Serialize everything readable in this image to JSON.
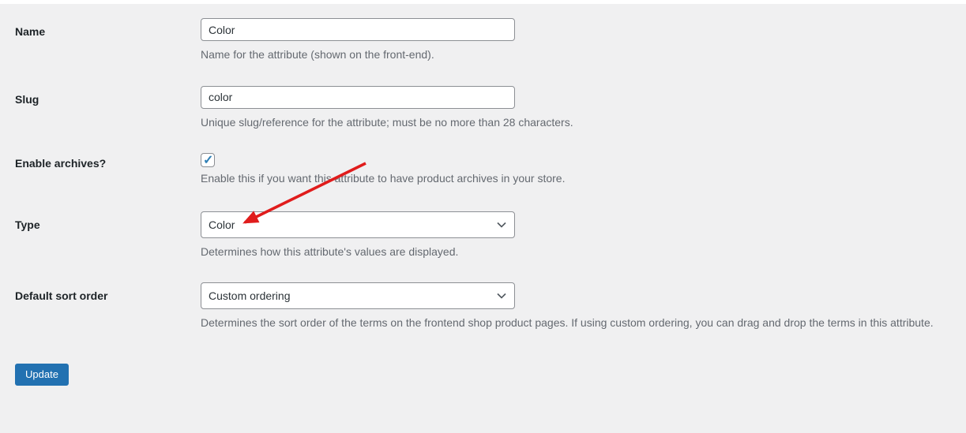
{
  "page": {
    "background": "#f0f0f1",
    "accent_blue": "#2271b1",
    "annotation_red": "#e01c1c"
  },
  "form": {
    "rows": [
      {
        "id": "name",
        "label": "Name",
        "type": "text",
        "value": "Color",
        "help": "Name for the attribute (shown on the front-end)."
      },
      {
        "id": "slug",
        "label": "Slug",
        "type": "text",
        "value": "color",
        "help": "Unique slug/reference for the attribute; must be no more than 28 characters."
      },
      {
        "id": "enable-archives",
        "label": "Enable archives?",
        "type": "checkbox",
        "checked": "checked",
        "help": "Enable this if you want this attribute to have product archives in your store."
      },
      {
        "id": "type",
        "label": "Type",
        "type": "select",
        "value": "Color",
        "help": "Determines how this attribute's values are displayed."
      },
      {
        "id": "default-sort-order",
        "label": "Default sort order",
        "type": "select",
        "value": "Custom ordering",
        "help": "Determines the sort order of the terms on the frontend shop product pages. If using custom ordering, you can drag and drop the terms in this attribute."
      }
    ],
    "update_button_label": "Update"
  },
  "annotation": {
    "shape": "red-arrow",
    "color": "#e01c1c",
    "points_at": "type-select-value"
  }
}
